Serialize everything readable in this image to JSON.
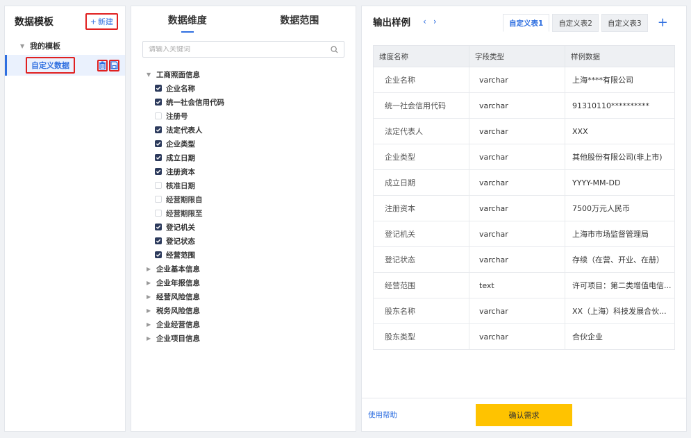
{
  "left": {
    "title": "数据模板",
    "new_label": "新建",
    "root_label": "我的模板",
    "template_name": "自定义数据"
  },
  "middle": {
    "tabs": [
      "数据维度",
      "数据范围"
    ],
    "search_placeholder": "请输入关键词",
    "groups": [
      {
        "label": "工商照面信息",
        "expanded": true,
        "fields": [
          {
            "label": "企业名称",
            "checked": true
          },
          {
            "label": "统一社会信用代码",
            "checked": true
          },
          {
            "label": "注册号",
            "checked": false
          },
          {
            "label": "法定代表人",
            "checked": true
          },
          {
            "label": "企业类型",
            "checked": true
          },
          {
            "label": "成立日期",
            "checked": true
          },
          {
            "label": "注册资本",
            "checked": true
          },
          {
            "label": "核准日期",
            "checked": false
          },
          {
            "label": "经营期限自",
            "checked": false
          },
          {
            "label": "经营期限至",
            "checked": false
          },
          {
            "label": "登记机关",
            "checked": true
          },
          {
            "label": "登记状态",
            "checked": true
          },
          {
            "label": "经营范围",
            "checked": true
          }
        ]
      },
      {
        "label": "企业基本信息",
        "expanded": false,
        "fields": []
      },
      {
        "label": "企业年报信息",
        "expanded": false,
        "fields": []
      },
      {
        "label": "经营风险信息",
        "expanded": false,
        "fields": []
      },
      {
        "label": "税务风险信息",
        "expanded": false,
        "fields": []
      },
      {
        "label": "企业经营信息",
        "expanded": false,
        "fields": []
      },
      {
        "label": "企业项目信息",
        "expanded": false,
        "fields": []
      }
    ]
  },
  "right": {
    "title": "输出样例",
    "tabs": [
      "自定义表1",
      "自定义表2",
      "自定义表3"
    ],
    "active_tab": 0,
    "columns": [
      "维度名称",
      "字段类型",
      "样例数据"
    ],
    "rows": [
      [
        "企业名称",
        "varchar",
        "上海****有限公司"
      ],
      [
        "统一社会信用代码",
        "varchar",
        "91310110**********"
      ],
      [
        "法定代表人",
        "varchar",
        "XXX"
      ],
      [
        "企业类型",
        "varchar",
        "其他股份有限公司(非上市)"
      ],
      [
        "成立日期",
        "varchar",
        "YYYY-MM-DD"
      ],
      [
        "注册资本",
        "varchar",
        "7500万元人民币"
      ],
      [
        "登记机关",
        "varchar",
        "上海市市场监督管理局"
      ],
      [
        "登记状态",
        "varchar",
        "存续（在营、开业、在册）"
      ],
      [
        "经营范围",
        "text",
        "许可项目：第二类增值电信..."
      ],
      [
        "股东名称",
        "varchar",
        "XX（上海）科技发展合伙..."
      ],
      [
        "股东类型",
        "varchar",
        "合伙企业"
      ]
    ],
    "help_label": "使用帮助",
    "confirm_label": "确认需求"
  },
  "colors": {
    "accent": "#2f6fe0",
    "highlight_border": "#e02020",
    "confirm_bg": "#ffc300",
    "checkbox_on": "#2c3a5c"
  }
}
